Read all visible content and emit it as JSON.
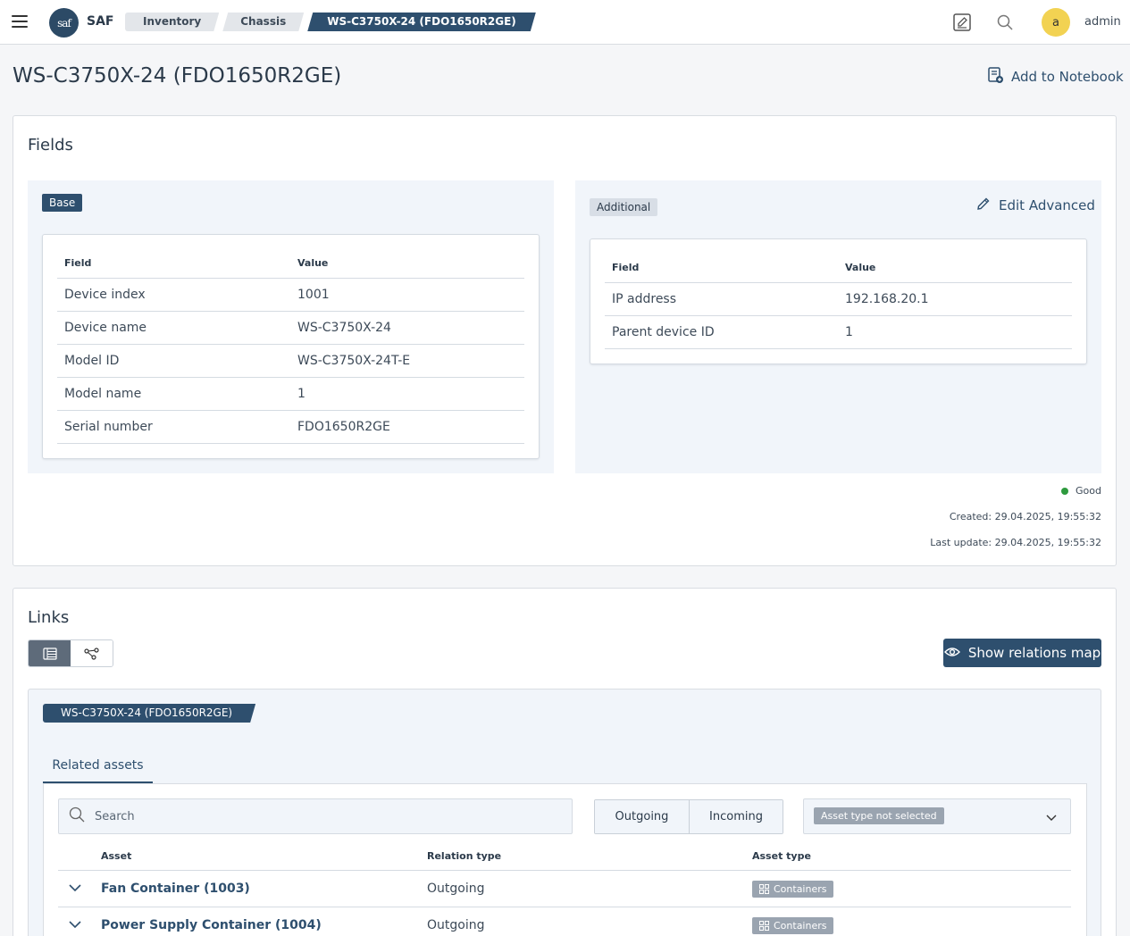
{
  "app": {
    "logo_text": "saf",
    "name": "SAF"
  },
  "breadcrumbs": [
    "Inventory",
    "Chassis",
    "WS-C3750X-24 (FDO1650R2GE)"
  ],
  "user": {
    "avatar_initial": "a",
    "name": "admin"
  },
  "page": {
    "title": "WS-C3750X-24 (FDO1650R2GE)",
    "add_notebook_label": "Add to Notebook"
  },
  "fields_card": {
    "title": "Fields",
    "base": {
      "tag": "Base",
      "headers": [
        "Field",
        "Value"
      ],
      "rows": [
        [
          "Device index",
          "1001"
        ],
        [
          "Device name",
          "WS-C3750X-24"
        ],
        [
          "Model ID",
          "WS-C3750X-24T-E"
        ],
        [
          "Model name",
          "1"
        ],
        [
          "Serial number",
          "FDO1650R2GE"
        ]
      ]
    },
    "additional": {
      "tag": "Additional",
      "edit_label": "Edit Advanced",
      "headers": [
        "Field",
        "Value"
      ],
      "rows": [
        [
          "IP address",
          "192.168.20.1"
        ],
        [
          "Parent device ID",
          "1"
        ]
      ]
    },
    "status": "Good",
    "created": "Created: 29.04.2025, 19:55:32",
    "last_update": "Last update: 29.04.2025, 19:55:32"
  },
  "links_card": {
    "title": "Links",
    "show_map_label": "Show relations map",
    "asset_tag": "WS-C3750X-24 (FDO1650R2GE)",
    "tab_label": "Related assets",
    "search_placeholder": "Search",
    "direction_options": [
      "Outgoing",
      "Incoming"
    ],
    "asset_type_filter": "Asset type not selected",
    "headers": [
      "Asset",
      "Relation type",
      "Asset type"
    ],
    "rows": [
      {
        "asset": "Fan Container (1003)",
        "relation": "Outgoing",
        "type": "Containers"
      },
      {
        "asset": "Power Supply Container (1004)",
        "relation": "Outgoing",
        "type": "Containers"
      }
    ]
  },
  "colors": {
    "primary": "#2e4f6e",
    "panel": "#f1f5fa",
    "status_good": "#2e9a3e",
    "avatar": "#f2d252"
  }
}
